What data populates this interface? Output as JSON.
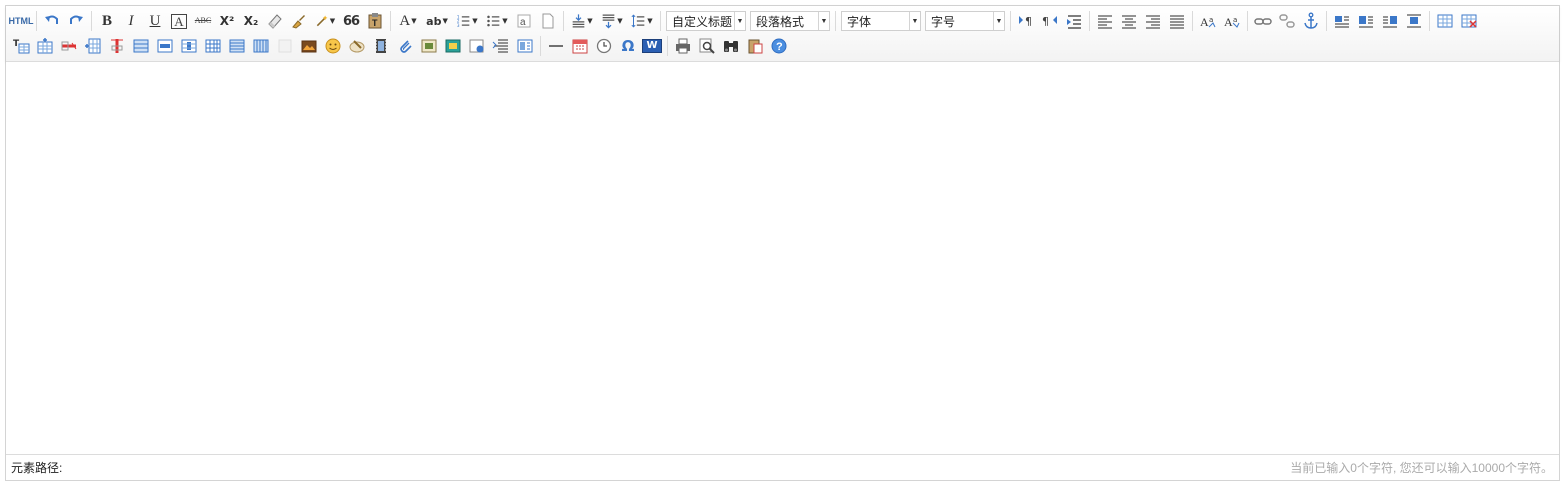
{
  "toolbar": {
    "combos": {
      "custom_heading": "自定义标题",
      "paragraph_format": "段落格式",
      "font_family": "字体",
      "font_size": "字号"
    },
    "labels": {
      "source": "HTML",
      "bold": "B",
      "italic": "I",
      "underline": "U",
      "fontborder": "A",
      "strikethrough": "ABC",
      "superscript": "X²",
      "subscript": "X₂",
      "blockquote": "66",
      "forecolor": "A",
      "backcolor": "ab",
      "omega": "Ω",
      "word": "W"
    }
  },
  "colors": {
    "accent_blue": "#3b77c8",
    "icon_gray": "#555555",
    "border": "#d4d4d4"
  },
  "statusbar": {
    "element_path": "元素路径:",
    "word_count": "当前已输入0个字符, 您还可以输入10000个字符。"
  }
}
